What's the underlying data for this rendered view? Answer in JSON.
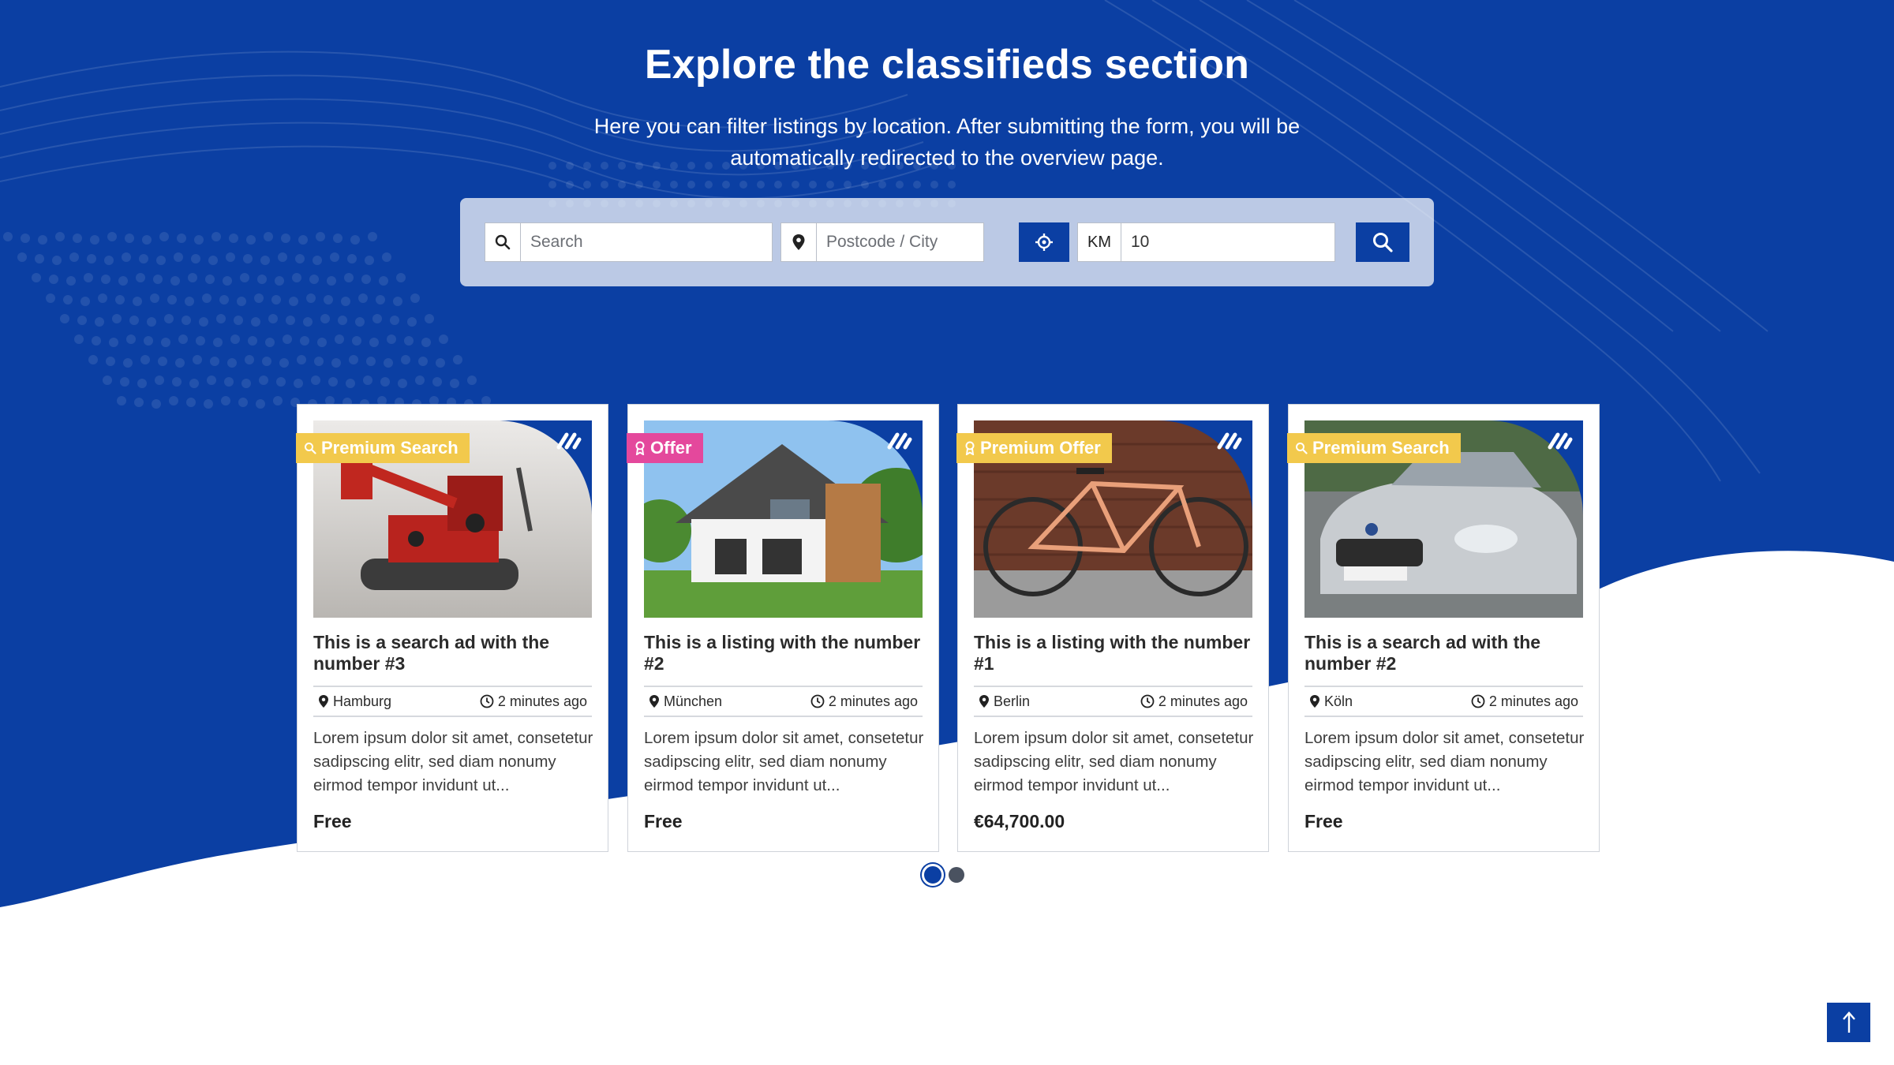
{
  "hero": {
    "title": "Explore the classifieds section",
    "subtitle": "Here you can filter listings by location. After submitting the form, you will be automatically redirected to the overview page."
  },
  "search": {
    "query_placeholder": "Search",
    "location_placeholder": "Postcode / City",
    "radius_unit": "KM",
    "radius_value": "10"
  },
  "colors": {
    "primary": "#0b3fa3",
    "badge_yellow": "#f2c94c",
    "badge_pink": "#e4489c"
  },
  "listings": [
    {
      "badge": "Premium Search",
      "badge_icon": "search-icon",
      "title": "This is a search ad with the number #3",
      "city": "Hamburg",
      "time": "2 minutes ago",
      "description": "Lorem ipsum dolor sit amet, consetetur sadipscing elitr, sed diam nonumy eirmod tempor invidunt ut...",
      "price": "Free"
    },
    {
      "badge": "Offer",
      "badge_icon": "award-icon",
      "title": "This is a listing with the number #2",
      "city": "München",
      "time": "2 minutes ago",
      "description": "Lorem ipsum dolor sit amet, consetetur sadipscing elitr, sed diam nonumy eirmod tempor invidunt ut...",
      "price": "Free"
    },
    {
      "badge": "Premium Offer",
      "badge_icon": "award-icon",
      "title": "This is a listing with the number #1",
      "city": "Berlin",
      "time": "2 minutes ago",
      "description": "Lorem ipsum dolor sit amet, consetetur sadipscing elitr, sed diam nonumy eirmod tempor invidunt ut...",
      "price": "€64,700.00"
    },
    {
      "badge": "Premium Search",
      "badge_icon": "search-icon",
      "title": "This is a search ad with the number #2",
      "city": "Köln",
      "time": "2 minutes ago",
      "description": "Lorem ipsum dolor sit amet, consetetur sadipscing elitr, sed diam nonumy eirmod tempor invidunt ut...",
      "price": "Free"
    }
  ],
  "carousel": {
    "pages": 2,
    "active": 1
  }
}
